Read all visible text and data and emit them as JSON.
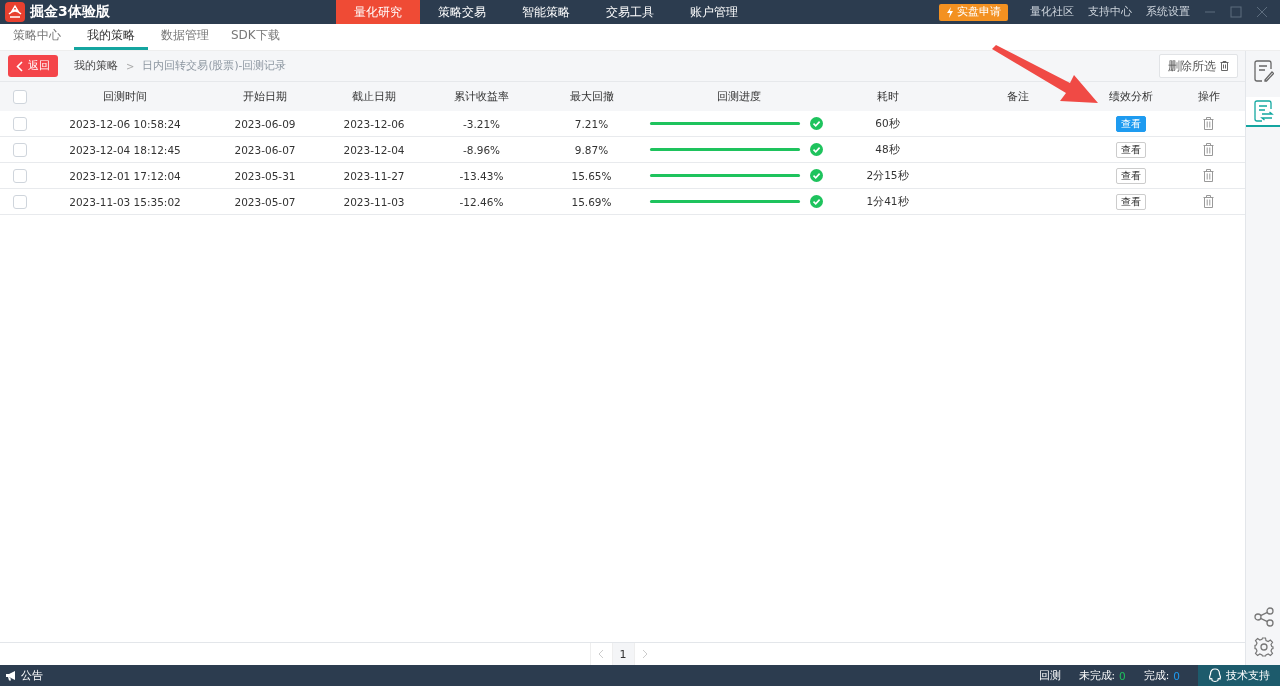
{
  "app": {
    "title": "掘金3体验版"
  },
  "main_nav": [
    {
      "label": "量化研究",
      "selected": true
    },
    {
      "label": "策略交易",
      "selected": false
    },
    {
      "label": "智能策略",
      "selected": false
    },
    {
      "label": "交易工具",
      "selected": false
    },
    {
      "label": "账户管理",
      "selected": false
    }
  ],
  "live_apply_button": "实盘申请",
  "top_links": [
    "量化社区",
    "支持中心",
    "系统设置"
  ],
  "sub_tabs": [
    {
      "label": "策略中心",
      "selected": false
    },
    {
      "label": "我的策略",
      "selected": true
    },
    {
      "label": "数据管理",
      "selected": false
    },
    {
      "label": "SDK下载",
      "selected": false
    }
  ],
  "back_button": "返回",
  "breadcrumb": [
    "我的策略",
    "日内回转交易(股票)-回测记录"
  ],
  "breadcrumb_separator": ">",
  "delete_selected_button": "删除所选",
  "table": {
    "header_checked": false,
    "columns": [
      "回测时间",
      "开始日期",
      "截止日期",
      "累计收益率",
      "最大回撤",
      "回测进度",
      "耗时",
      "备注",
      "绩效分析",
      "操作"
    ],
    "rows": [
      {
        "checked": false,
        "time": "2023-12-06 10:58:24",
        "start": "2023-06-09",
        "end": "2023-12-06",
        "return": "-3.21%",
        "drawdown": "7.21%",
        "level": 1,
        "done": true,
        "duration": "60秒",
        "note": "",
        "view": "查看",
        "view_highlighted": true
      },
      {
        "checked": false,
        "time": "2023-12-04 18:12:45",
        "start": "2023-06-07",
        "end": "2023-12-04",
        "return": "-8.96%",
        "drawdown": "9.87%",
        "level": 1,
        "done": true,
        "duration": "48秒",
        "note": "",
        "view": "查看",
        "view_highlighted": false
      },
      {
        "checked": false,
        "time": "2023-12-01 17:12:04",
        "start": "2023-05-31",
        "end": "2023-11-27",
        "return": "-13.43%",
        "drawdown": "15.65%",
        "level": 1,
        "done": true,
        "duration": "2分15秒",
        "note": "",
        "view": "查看",
        "view_highlighted": false
      },
      {
        "checked": false,
        "time": "2023-11-03 15:35:02",
        "start": "2023-05-07",
        "end": "2023-11-03",
        "return": "-12.46%",
        "drawdown": "15.69%",
        "level": 1,
        "done": true,
        "duration": "1分41秒",
        "note": "",
        "view": "查看",
        "view_highlighted": false
      }
    ]
  },
  "pagination": {
    "pages": [
      {
        "label": "1",
        "selected": true
      }
    ]
  },
  "right_rail": [
    {
      "kind": "edit",
      "selected": false
    },
    {
      "kind": "records",
      "selected": true
    }
  ],
  "status_bar": {
    "notice": "公告",
    "backtest": "回测",
    "unfinished_label": "未完成:",
    "unfinished_count": "0",
    "finished_label": "完成:",
    "finished_count": "0",
    "support": "技术支持"
  },
  "annotation": {
    "kind": "arrow"
  }
}
